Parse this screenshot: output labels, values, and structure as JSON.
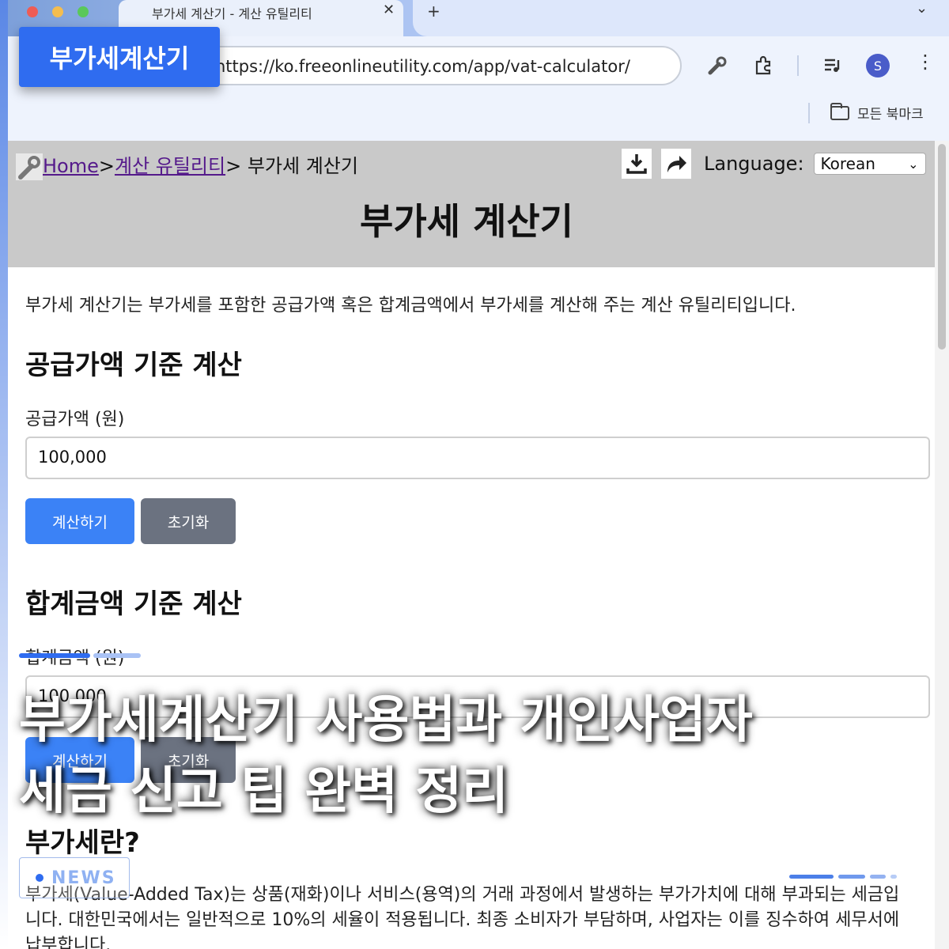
{
  "browser": {
    "tab_title": "부가세 계산기 - 계산 유틸리티",
    "url": "https://ko.freeonlineutility.com/app/vat-calculator/",
    "profile_initial": "S",
    "bookmarks_label": "모든 북마크"
  },
  "page": {
    "breadcrumb": {
      "home": "Home",
      "sep1": ">",
      "category": "계산 유틸리티",
      "current": "> 부가세 계산기"
    },
    "language_label": "Language:",
    "language_value": "Korean",
    "title": "부가세 계산기",
    "intro": "부가세 계산기는 부가세를 포함한 공급가액 혹은 합계금액에서 부가세를 계산해 주는 계산 유틸리티입니다.",
    "section1": {
      "heading": "공급가액 기준 계산",
      "label": "공급가액 (원)",
      "value": "100,000",
      "calc_button": "계산하기",
      "reset_button": "초기화"
    },
    "section2": {
      "heading": "합계금액 기준 계산",
      "label": "합계금액 (원)",
      "value": "100,000",
      "calc_button": "계산하기",
      "reset_button": "초기화"
    },
    "section3": {
      "heading": "부가세란?",
      "paragraph": "부가세(Value-Added Tax)는 상품(재화)이나 서비스(용역)의 거래 과정에서 발생하는 부가가치에 대해 부과되는 세금입니다. 대한민국에서는 일반적으로 10%의 세율이 적용됩니다. 최종 소비자가 부담하며, 사업자는 이를 징수하여 세무서에 납부합니다."
    }
  },
  "overlay": {
    "tag": "부가세계산기",
    "headline_line1": "부가세계산기 사용법과 개인사업자",
    "headline_line2": "세금 신고 팁 완벽 정리",
    "news_label": "NEWS"
  },
  "colors": {
    "accent": "#2f6cf0",
    "primary_button": "#3b82f6",
    "secondary_button": "#6b7280",
    "header_band": "#c9c9c9"
  }
}
